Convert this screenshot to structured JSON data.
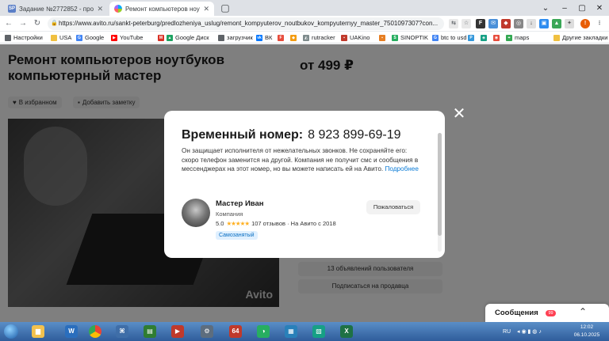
{
  "browser": {
    "tabs": [
      {
        "favicon": "SP",
        "title": "Задание №2772852 - просмотр з",
        "active": false
      },
      {
        "favicon": "avito-icon",
        "title": "Ремонт компьютеров ноутбуков",
        "active": true
      },
      {
        "favicon": "blank-page-icon",
        "title": "",
        "active": false
      }
    ],
    "url": "https://www.avito.ru/sankt-peterburg/predlozheniya_uslug/remont_kompyuterov_noutbukov_kompyuternyy_master_7501097307?con...",
    "bookmarks": [
      "Настройки",
      "USA",
      "Google",
      "YouTube",
      "Google Диск",
      "загрузчик",
      "ВК",
      "rutracker",
      "UAKino",
      "SINOPTIK",
      "btc to usd",
      "maps",
      "Другие закладки"
    ]
  },
  "listing": {
    "title": "Ремонт компьютеров ноутбуков компьютерный мастер",
    "price": "от 499 ₽",
    "favorite_label": "В избранном",
    "note_label": "Добавить заметку",
    "watermark": "Avito",
    "sidebar_buttons": [
      "13 объявлений пользователя",
      "Подписаться на продавца"
    ]
  },
  "modal": {
    "title": "Временный номер:",
    "phone": "8 923 899-69-19",
    "description": "Он защищает исполнителя от нежелательных звонков. Не сохраняйте его: скоро телефон заменится на другой. Компания не получит смс и сообщения в мессенджерах на этот номер, но вы можете написать ей на Авито.",
    "more_link": "Подробнее",
    "seller": {
      "name": "Мастер Иван",
      "type": "Компания",
      "rating": "5.0",
      "stars": "★★★★★",
      "reviews": "107 отзывов",
      "since": "· На Авито с 2018",
      "badge": "Самозанятый"
    },
    "report_label": "Пожаловаться"
  },
  "messages": {
    "label": "Сообщения",
    "count": "99"
  },
  "taskbar": {
    "lang": "RU",
    "time": "12:02",
    "date": "06.10.2025"
  }
}
